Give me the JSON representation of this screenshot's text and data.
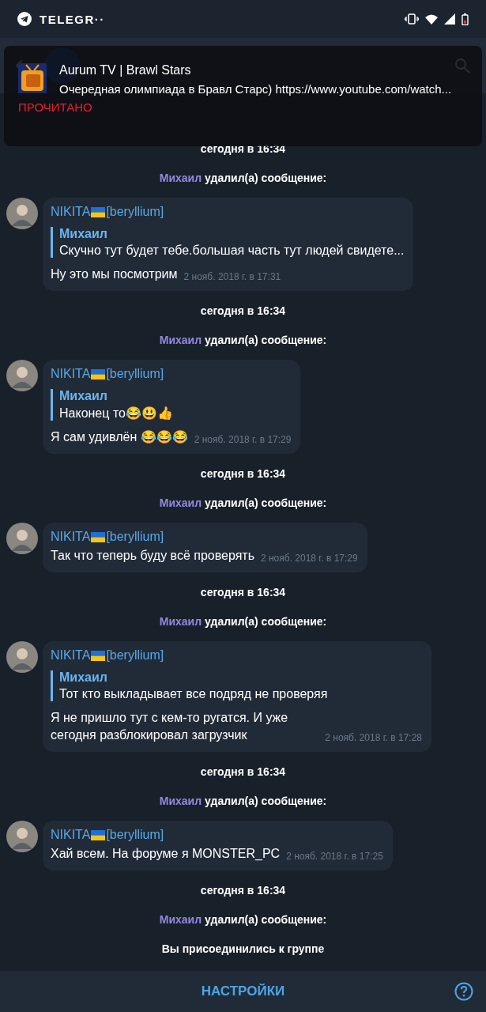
{
  "status_bar": {
    "app": "TELEGR··"
  },
  "notification": {
    "title": "Aurum TV | Brawl Stars",
    "text": "Очередная олимпиада в Бравл Старс) https://www.youtube.com/watch...",
    "action": "ПРОЧИТАНО"
  },
  "messages": [
    {
      "kind": "date",
      "text": "сегодня в 16:34"
    },
    {
      "kind": "service",
      "actor": "Михаил",
      "text": "удалил(а) сообщение:"
    },
    {
      "kind": "message",
      "author": "NIKITA",
      "tag": "[beryllium]",
      "reply": {
        "author": "Михаил",
        "text": "Скучно тут будет тебе.большая часть тут людей свидете..."
      },
      "text": "Ну это мы посмотрим",
      "time": "2 нояб. 2018 г. в 17:31"
    },
    {
      "kind": "date",
      "text": "сегодня в 16:34"
    },
    {
      "kind": "service",
      "actor": "Михаил",
      "text": "удалил(а) сообщение:"
    },
    {
      "kind": "message",
      "author": "NIKITA",
      "tag": "[beryllium]",
      "reply": {
        "author": "Михаил",
        "text": "Наконец то😂😃👍"
      },
      "text": "Я сам удивлён 😂😂😂",
      "time": "2 нояб. 2018 г. в 17:29"
    },
    {
      "kind": "date",
      "text": "сегодня в 16:34"
    },
    {
      "kind": "service",
      "actor": "Михаил",
      "text": "удалил(а) сообщение:"
    },
    {
      "kind": "message",
      "author": "NIKITA",
      "tag": "[beryllium]",
      "text": "Так что теперь буду всё проверять",
      "time": "2 нояб. 2018 г. в 17:29"
    },
    {
      "kind": "date",
      "text": "сегодня в 16:34"
    },
    {
      "kind": "service",
      "actor": "Михаил",
      "text": "удалил(а) сообщение:"
    },
    {
      "kind": "message",
      "author": "NIKITA",
      "tag": "[beryllium]",
      "reply": {
        "author": "Михаил",
        "text": "Тот кто выкладывает все подряд не проверяя"
      },
      "text": "Я не пришло тут с кем-то ругатся. И уже сегодня разблокировал загрузчик",
      "time": "2 нояб. 2018 г. в 17:28"
    },
    {
      "kind": "date",
      "text": "сегодня в 16:34"
    },
    {
      "kind": "service",
      "actor": "Михаил",
      "text": "удалил(а) сообщение:"
    },
    {
      "kind": "message",
      "author": "NIKITA",
      "tag": "[beryllium]",
      "text": "Хай всем. На форуме я MONSTER_PC",
      "time": "2 нояб. 2018 г. в 17:25"
    },
    {
      "kind": "date",
      "text": "сегодня в 16:34"
    },
    {
      "kind": "service",
      "actor": "Михаил",
      "text": "удалил(а) сообщение:"
    },
    {
      "kind": "service",
      "text": "Вы присоединились к группе"
    }
  ],
  "bottom_bar": {
    "button": "НАСТРОЙКИ"
  }
}
